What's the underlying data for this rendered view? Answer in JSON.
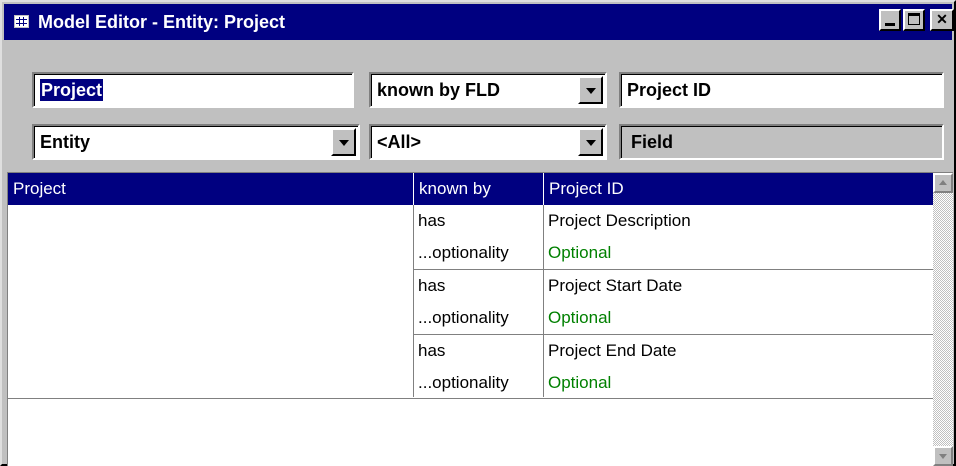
{
  "window": {
    "title": "Model Editor - Entity: Project",
    "icon": "table-icon",
    "controls": [
      "minimize-icon",
      "maximize-icon",
      "close-icon"
    ],
    "close_glyph": "✕"
  },
  "form": {
    "entity_name": "Project",
    "relation_value": "known by FLD",
    "target_value": "Project ID",
    "object_type_value": "Entity",
    "filter_value": "<All>",
    "target_type_label": "Field"
  },
  "grid": {
    "header": {
      "col1": "Project",
      "col2": "known by",
      "col3": "Project ID"
    },
    "rows": [
      {
        "relation": "has",
        "field": "Project Description",
        "optionality_label": "...optionality",
        "optionality": "Optional"
      },
      {
        "relation": "has",
        "field": "Project Start Date",
        "optionality_label": "...optionality",
        "optionality": "Optional"
      },
      {
        "relation": "has",
        "field": "Project End Date",
        "optionality_label": "...optionality",
        "optionality": "Optional"
      }
    ]
  },
  "colors": {
    "titlebar": "#000080",
    "window_face": "#c0c0c0",
    "selection": "#000080",
    "optional_text": "#008000"
  }
}
